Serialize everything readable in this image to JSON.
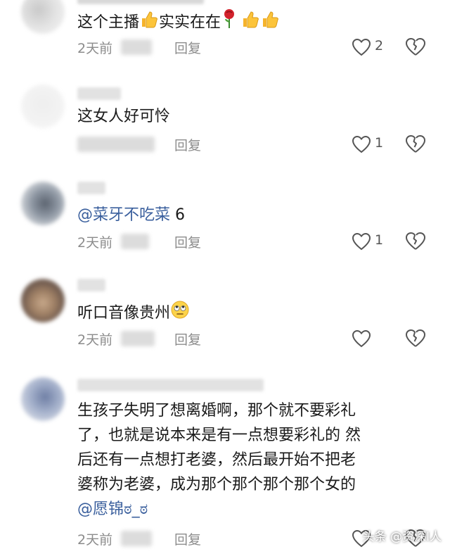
{
  "comments": [
    {
      "text": "这个主播",
      "text_tail": "实实在在",
      "meta": {
        "time": "2天前",
        "reply": "回复"
      },
      "likes": "2"
    },
    {
      "text": "这女人好可怜",
      "meta": {
        "reply": "回复"
      },
      "likes": "1"
    },
    {
      "mention": "@菜牙不吃菜",
      "text": " 6",
      "meta": {
        "time": "2天前",
        "reply": "回复"
      },
      "likes": "1"
    },
    {
      "text": "听口音像贵州",
      "meta": {
        "time": "2天前",
        "reply": "回复"
      },
      "likes": ""
    },
    {
      "lines": [
        "生孩子失明了想离婚啊，那个就不要彩礼",
        "了，也就是说本来是有一点想要彩礼的 然",
        "后还有一点想打老婆，然后最开始不把老",
        "婆称为老婆，成为那个那个那个那个女的"
      ],
      "mention": "@愿锦ಠ_ಠ",
      "meta": {
        "time": "2天前",
        "reply": "回复"
      },
      "likes": ""
    }
  ],
  "icons": {
    "like": "heart-outline-icon",
    "dislike": "broken-heart-outline-icon",
    "thumbs": "thumbs-up-emoji",
    "rose": "rose-emoji",
    "rolling_eyes": "rolling-eyes-emoji"
  },
  "colors": {
    "mention": "#3a5f9d",
    "meta": "#8c8c8c",
    "text": "#1a1a1a"
  },
  "watermark": "头条 @资深I人"
}
